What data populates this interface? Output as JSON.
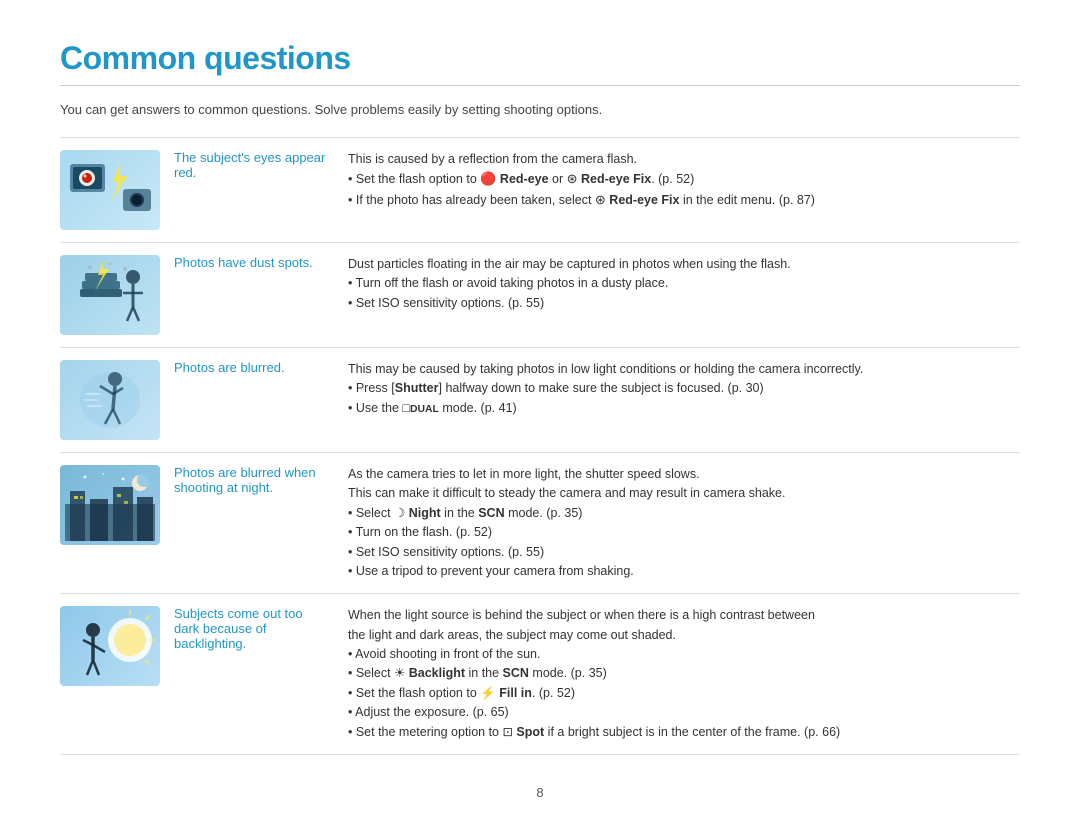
{
  "page": {
    "title": "Common questions",
    "subtitle": "You can get answers to common questions. Solve problems easily by setting shooting options.",
    "page_number": "8"
  },
  "rows": [
    {
      "id": "redeye",
      "problem": "The subject's eyes appear red.",
      "solutions": [
        {
          "type": "text",
          "content": "This is caused by a reflection from the camera flash."
        },
        {
          "type": "bullet",
          "content": "Set the flash option to "
        },
        {
          "type": "bullet",
          "content": "If the photo has already been taken, select "
        }
      ],
      "solution_html": "This is caused by a reflection from the camera flash.<br>• Set the flash option to <span class='icon-redeye'>🔴</span> <strong>Red-eye</strong> or <span class='icon-redeye'>🔴</span> <strong>Red-eye Fix</strong>. (p. 52)<br>• If the photo has already been taken, select <span class='icon-redeye'>⊛</span> <strong>Red-eye Fix</strong> in the edit menu. (p. 87)"
    },
    {
      "id": "dust",
      "problem": "Photos have dust spots.",
      "solution_html": "Dust particles floating in the air may be captured in photos when using the flash.<br>• Turn off the flash or avoid taking photos in a dusty place.<br>• Set ISO sensitivity options. (p. 55)"
    },
    {
      "id": "blur",
      "problem": "Photos are blurred.",
      "solution_html": "This may be caused by taking photos in low light conditions or holding the camera incorrectly.<br>• Press [<strong>Shutter</strong>] halfway down to make sure the subject is focused. (p. 30)<br>• Use the <span class='dual-icon'>⊞</span><span class='scn-text'>DUAL</span> mode. (p. 41)"
    },
    {
      "id": "night",
      "problem": "Photos are blurred when shooting at night.",
      "solution_html": "As the camera tries to let in more light, the shutter speed slows.<br>This can make it difficult to steady the camera and may result in camera shake.<br>• Select ☽ <strong>Night</strong> in the <span class='scn-text'>SCN</span> mode. (p. 35)<br>• Turn on the flash. (p. 52)<br>• Set ISO sensitivity options. (p. 55)<br>• Use a tripod to prevent your camera from shaking."
    },
    {
      "id": "backlight",
      "problem": "Subjects come out too dark because of backlighting.",
      "solution_html": "When the light source is behind the subject or when there is a high contrast between<br>the light and dark areas, the subject may come out shaded.<br>• Avoid shooting in front of the sun.<br>• Select <span style='font-size:11px'>☀</span> <strong>Backlight</strong> in the <span class='scn-text'>SCN</span> mode. (p. 35)<br>• Set the flash option to ⚡ <strong>Fill in</strong>. (p. 52)<br>• Adjust the exposure. (p. 65)<br>• Set the metering option to ⊡ <strong>Spot</strong> if a bright subject is in the center of the frame. (p. 66)"
    }
  ]
}
